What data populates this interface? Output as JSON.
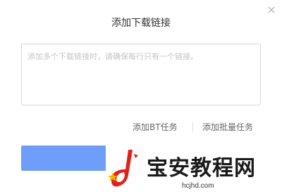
{
  "dialog": {
    "title": "添加下载链接",
    "close_icon": "close-icon"
  },
  "input": {
    "placeholder": "添加多个下载链接时，请确保每行只有一个链接。",
    "value": ""
  },
  "actions": {
    "bt_task_label": "添加BT任务",
    "batch_task_label": "添加批量任务"
  },
  "confirm": {
    "label": ""
  },
  "watermark": {
    "text": "宝安教程网",
    "url": "hcjhd.com"
  },
  "colors": {
    "accent": "#6e9ef9",
    "logo_red": "#e0201b",
    "logo_yellow": "#f5b400"
  }
}
